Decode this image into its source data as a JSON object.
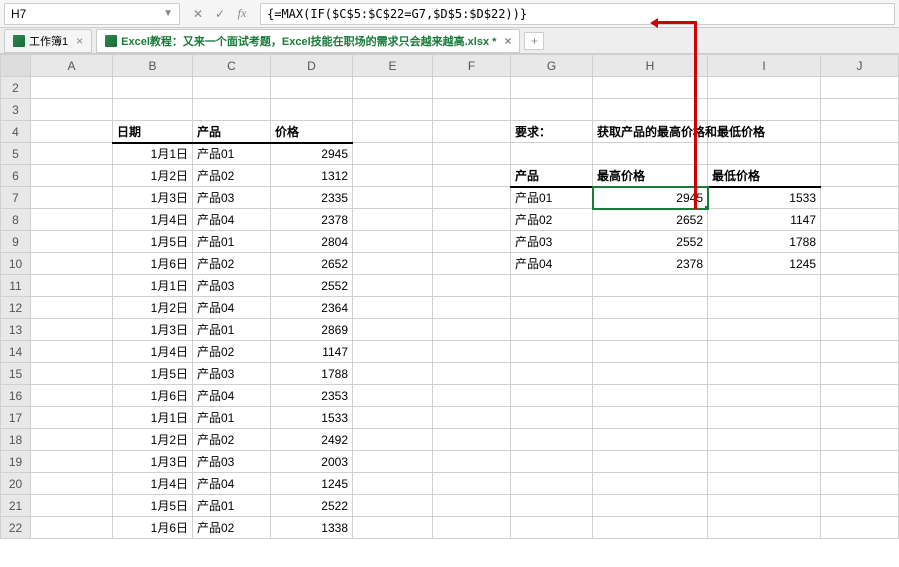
{
  "nameBox": {
    "value": "H7"
  },
  "formulaBar": {
    "formula": "{=MAX(IF($C$5:$C$22=G7,$D$5:$D$22))}"
  },
  "tabs": {
    "items": [
      {
        "label": "工作簿1",
        "active": false,
        "close": "×"
      },
      {
        "label": "Excel教程：又来一个面试考题，Excel技能在职场的需求只会越来越高.xlsx *",
        "active": true,
        "close": "×"
      }
    ],
    "plus": "+"
  },
  "columns": [
    "A",
    "B",
    "C",
    "D",
    "E",
    "F",
    "G",
    "H",
    "I",
    "J"
  ],
  "rowStart": 2,
  "rowEnd": 22,
  "selectedCell": {
    "row": 7,
    "col": "H"
  },
  "headers": {
    "b4": "日期",
    "c4": "产品",
    "d4": "价格",
    "g4": "要求：",
    "h4": "获取产品的最高价格和最低价格",
    "g6": "产品",
    "h6": "最高价格",
    "i6": "最低价格"
  },
  "leftData": [
    {
      "b": "1月1日",
      "c": "产品01",
      "d": "2945"
    },
    {
      "b": "1月2日",
      "c": "产品02",
      "d": "1312"
    },
    {
      "b": "1月3日",
      "c": "产品03",
      "d": "2335"
    },
    {
      "b": "1月4日",
      "c": "产品04",
      "d": "2378"
    },
    {
      "b": "1月5日",
      "c": "产品01",
      "d": "2804"
    },
    {
      "b": "1月6日",
      "c": "产品02",
      "d": "2652"
    },
    {
      "b": "1月1日",
      "c": "产品03",
      "d": "2552"
    },
    {
      "b": "1月2日",
      "c": "产品04",
      "d": "2364"
    },
    {
      "b": "1月3日",
      "c": "产品01",
      "d": "2869"
    },
    {
      "b": "1月4日",
      "c": "产品02",
      "d": "1147"
    },
    {
      "b": "1月5日",
      "c": "产品03",
      "d": "1788"
    },
    {
      "b": "1月6日",
      "c": "产品04",
      "d": "2353"
    },
    {
      "b": "1月1日",
      "c": "产品01",
      "d": "1533"
    },
    {
      "b": "1月2日",
      "c": "产品02",
      "d": "2492"
    },
    {
      "b": "1月3日",
      "c": "产品03",
      "d": "2003"
    },
    {
      "b": "1月4日",
      "c": "产品04",
      "d": "1245"
    },
    {
      "b": "1月5日",
      "c": "产品01",
      "d": "2522"
    },
    {
      "b": "1月6日",
      "c": "产品02",
      "d": "1338"
    }
  ],
  "rightData": [
    {
      "g": "产品01",
      "h": "2945",
      "i": "1533"
    },
    {
      "g": "产品02",
      "h": "2652",
      "i": "1147"
    },
    {
      "g": "产品03",
      "h": "2552",
      "i": "1788"
    },
    {
      "g": "产品04",
      "h": "2378",
      "i": "1245"
    }
  ]
}
